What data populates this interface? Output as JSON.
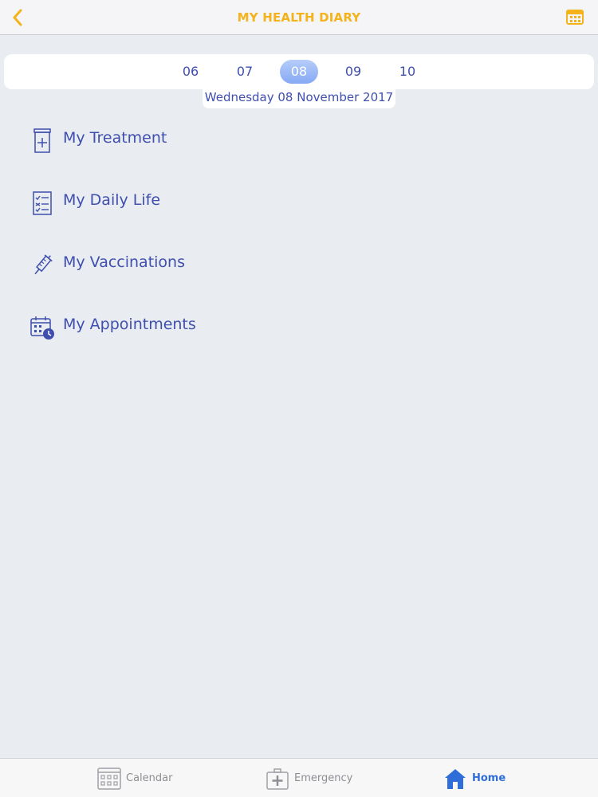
{
  "navbar": {
    "title": "MY HEALTH DIARY",
    "back_icon": "chevron-left-icon",
    "calendar_icon": "calendar-icon",
    "accent_color": "#f4b21b"
  },
  "date_strip": {
    "days": [
      "06",
      "07",
      "08",
      "09",
      "10"
    ],
    "selected": "08",
    "selected_date_label": "Wednesday 08 November 2017"
  },
  "menu": {
    "items": [
      {
        "label": "My Treatment",
        "icon": "medicine-bottle-icon"
      },
      {
        "label": "My Daily Life",
        "icon": "checklist-icon"
      },
      {
        "label": "My Vaccinations",
        "icon": "syringe-icon"
      },
      {
        "label": "My Appointments",
        "icon": "calendar-clock-icon"
      }
    ],
    "text_color": "#3f4fad"
  },
  "tabbar": {
    "tabs": [
      {
        "label": "Calendar",
        "icon": "calendar-grid-icon"
      },
      {
        "label": "Emergency",
        "icon": "first-aid-kit-icon"
      },
      {
        "label": "Home",
        "icon": "home-icon"
      }
    ],
    "active": "Home",
    "active_color": "#2f6ed8"
  }
}
